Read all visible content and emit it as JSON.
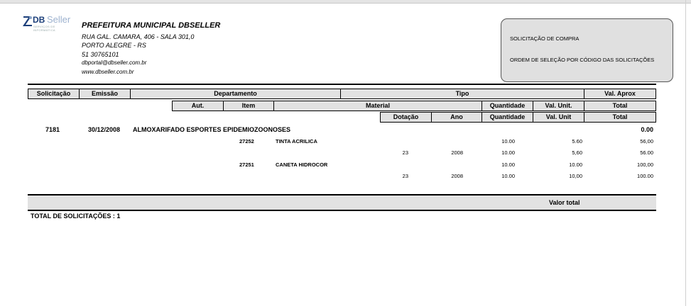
{
  "company": {
    "logo_text_bold": "DB",
    "logo_text_light": "Seller",
    "logo_tagline": "SERVIÇOS DE INFORMÁTICA",
    "name": "PREFEITURA MUNICIPAL DBSELLER",
    "address": "RUA GAL. CAMARA, 406 - SALA 301,0",
    "city": "PORTO ALEGRE - RS",
    "phone": "51 30765101",
    "email": "dbportal@dbseller.com.br",
    "website": "www.dbseller.com.br"
  },
  "report": {
    "title": "SOLICITAÇÃO DE COMPRA",
    "subtitle": "ORDEM DE SELEÇÃO POR CÓDIGO DAS SOLICITAÇÕES"
  },
  "headers": {
    "row1": {
      "solicitacao": "Solicitação",
      "emissao": "Emissão",
      "departamento": "Departamento",
      "tipo": "Tipo",
      "val_aprox": "Val. Aprox"
    },
    "row2": {
      "aut": "Aut.",
      "item": "Item",
      "material": "Material",
      "quantidade": "Quantidade",
      "val_unit": "Val. Unit.",
      "total": "Total"
    },
    "row3": {
      "dotacao": "Dotação",
      "ano": "Ano",
      "quantidade": "Quantidade",
      "val_unit": "Val. Unit",
      "total": "Total"
    }
  },
  "solicitation": {
    "number": "7181",
    "date": "30/12/2008",
    "department": "ALMOXARIFADO ESPORTES EPIDEMIOZOONOSES",
    "val_aprox": "0.00",
    "items": [
      {
        "item": "27252",
        "material": "TINTA ACRILICA",
        "quantidade": "10.00",
        "val_unit": "5.60",
        "total": "56,00",
        "dot": {
          "dotacao": "23",
          "ano": "2008",
          "quantidade": "10.00",
          "val_unit": "5,60",
          "total": "56.00"
        }
      },
      {
        "item": "27251",
        "material": "CANETA HIDROCOR",
        "quantidade": "10.00",
        "val_unit": "10.00",
        "total": "100,00",
        "dot": {
          "dotacao": "23",
          "ano": "2008",
          "quantidade": "10.00",
          "val_unit": "10,00",
          "total": "100.00"
        }
      }
    ]
  },
  "footer": {
    "valor_total_label": "Valor total",
    "total_solicitacoes": "TOTAL DE SOLICITAÇÕES  :  1"
  }
}
